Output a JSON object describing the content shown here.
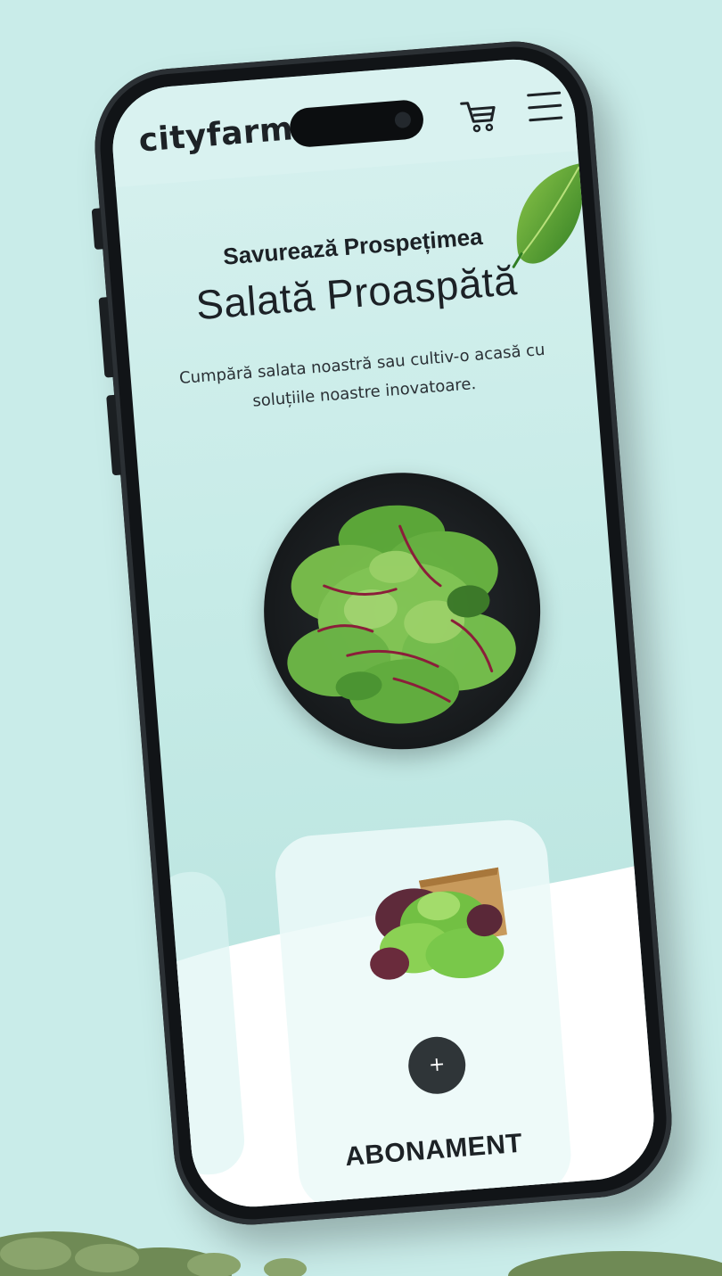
{
  "header": {
    "logo": "cityfarm",
    "cart_icon": "cart-icon",
    "menu_icon": "hamburger-menu-icon"
  },
  "hero": {
    "eyebrow": "Savurează Prospețimea",
    "title": "Salată Proaspătă",
    "description": "Cumpără salata noastră sau cultiv-o acasă cu soluțiile noastre inovatoare.",
    "image": "salad-bowl-image"
  },
  "product_card": {
    "image": "lettuce-box-image",
    "add_label": "+",
    "title": "ABONAMENT"
  },
  "colors": {
    "background": "#c9ece9",
    "screen": "#c6ebe7",
    "text": "#1d2226",
    "button": "#2f3538"
  }
}
